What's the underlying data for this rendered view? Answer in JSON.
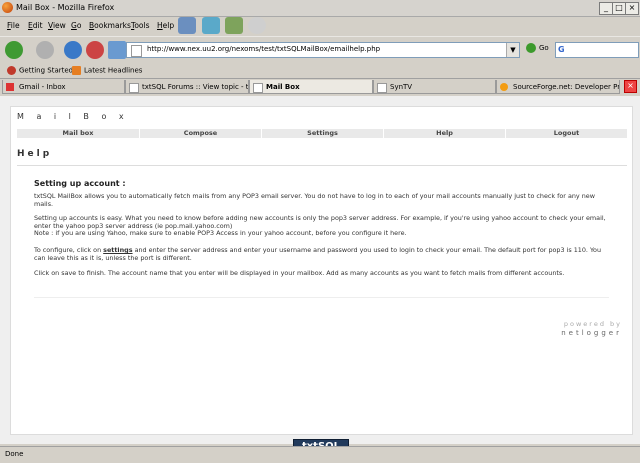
{
  "window": {
    "title": "Mail Box - Mozilla Firefox"
  },
  "menu": [
    "File",
    "Edit",
    "View",
    "Go",
    "Bookmarks",
    "Tools",
    "Help"
  ],
  "menu_mnemonics": [
    "F",
    "E",
    "V",
    "G",
    "B",
    "T",
    "H"
  ],
  "address": {
    "url": "http://www.nex.uu2.org/nexoms/test/txtSQLMailBox/emailhelp.php"
  },
  "go_label": "Go",
  "search_engine": "G",
  "bookmarks": [
    "Getting Started",
    "Latest Headlines"
  ],
  "tabs": [
    {
      "label": "Gmail - Inbox"
    },
    {
      "label": "txtSQL Forums :: View topic - tx..."
    },
    {
      "label": "Mail Box"
    },
    {
      "label": "SynTV"
    },
    {
      "label": "SourceForge.net: Developer Pr..."
    }
  ],
  "app": {
    "title": "M a i l   B o x",
    "nav": [
      "Mail box",
      "Compose",
      "Settings",
      "Help",
      "Logout"
    ],
    "page_title": "Help",
    "section_heading": "Setting up account :",
    "paragraphs": [
      "txtSQL MailBox allows you to automatically fetch mails from any POP3 email server. You do not have to log in to each of your mail accounts manually just to check for any new mails.",
      "Setting up accounts is easy. What you need to know before adding new accounts is only the pop3 server address. For example, if you're using yahoo account to check your email, enter the yahoo pop3 server address (ie pop.mail.yahoo.com)",
      "Note : if you are using Yahoo, make sure to enable POP3 Access in your yahoo account, before you configure it here.",
      "To configure, click on",
      "settings",
      "and enter the server address and enter your username and password you used to login to check your email. The default port for pop3 is 110. You can leave this as it is, unless the port is different.",
      "Click on save to finish. The account name that you enter will be displayed in your mailbox. Add as many accounts as you want to fetch mails from different accounts."
    ],
    "powered_by": "powered by",
    "powered_name": "netlogger",
    "logo_text": "txtSQL"
  },
  "status": "Done",
  "colors": {
    "accent": "#213a5c",
    "page_bg": "#efefef",
    "nav_bg": "#e9e9e9"
  }
}
